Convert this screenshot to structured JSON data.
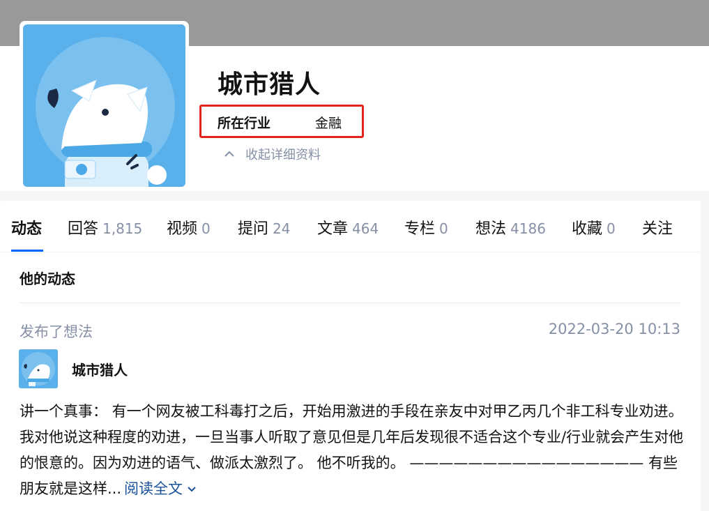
{
  "profile": {
    "name": "城市猎人",
    "industry_label": "所在行业",
    "industry_value": "金融",
    "collapse_label": "收起详细资料"
  },
  "tabs": [
    {
      "label": "动态",
      "count": ""
    },
    {
      "label": "回答",
      "count": "1,815"
    },
    {
      "label": "视频",
      "count": "0"
    },
    {
      "label": "提问",
      "count": "24"
    },
    {
      "label": "文章",
      "count": "464"
    },
    {
      "label": "专栏",
      "count": "0"
    },
    {
      "label": "想法",
      "count": "4186"
    },
    {
      "label": "收藏",
      "count": "0"
    },
    {
      "label": "关注",
      "count": ""
    }
  ],
  "feed": {
    "section_title": "他的动态",
    "item": {
      "action": "发布了想法",
      "timestamp": "2022-03-20 10:13",
      "author": "城市猎人",
      "content": "讲一个真事： 有一个网友被工科毒打之后，开始用激进的手段在亲友中对甲乙丙几个非工科专业劝进。我对他说这种程度的劝进，一旦当事人听取了意见但是几年后发现很不适合这个专业/行业就会产生对他的恨意的。因为劝进的语气、做派太激烈了。 他不听我的。 ———————————————— 有些朋友就是这样...",
      "read_more": "阅读全文"
    }
  },
  "colors": {
    "accent": "#0066ff",
    "link": "#175199",
    "muted": "#8590a6",
    "highlight_box": "#e2241c",
    "avatar_bg": "#5ab0ea"
  }
}
